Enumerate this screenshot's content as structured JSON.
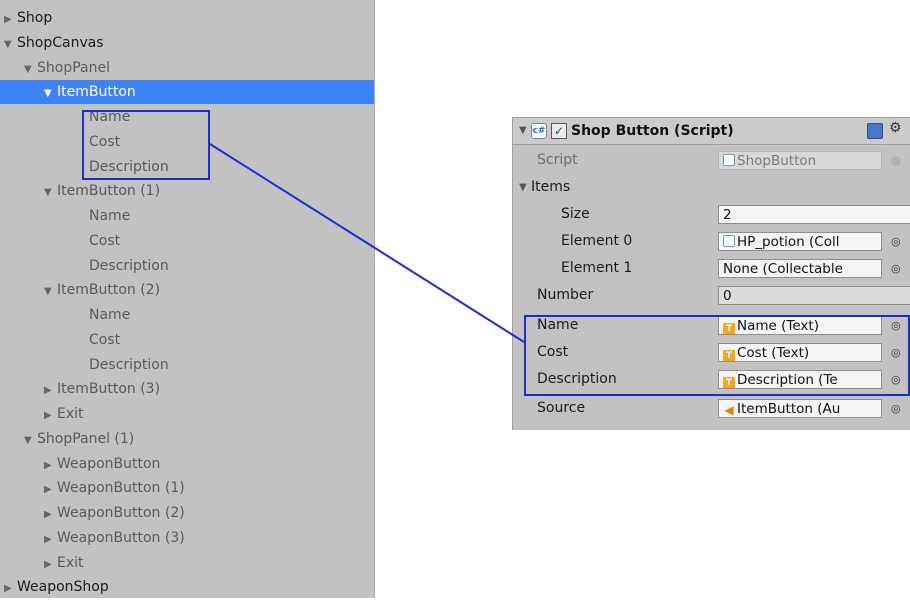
{
  "hierarchy": {
    "items": [
      {
        "label": "Shop",
        "arrow": "▶",
        "dim": false,
        "selected": false
      },
      {
        "label": "ShopCanvas",
        "arrow": "▼",
        "dim": false,
        "selected": false
      },
      {
        "label": "ShopPanel",
        "arrow": "▼",
        "dim": true,
        "selected": false
      },
      {
        "label": "ItemButton",
        "arrow": "▼",
        "dim": true,
        "selected": true
      },
      {
        "label": "Name",
        "arrow": "",
        "dim": true,
        "selected": false
      },
      {
        "label": "Cost",
        "arrow": "",
        "dim": true,
        "selected": false
      },
      {
        "label": "Description",
        "arrow": "",
        "dim": true,
        "selected": false
      },
      {
        "label": "ItemButton (1)",
        "arrow": "▼",
        "dim": true,
        "selected": false
      },
      {
        "label": "Name",
        "arrow": "",
        "dim": true,
        "selected": false
      },
      {
        "label": "Cost",
        "arrow": "",
        "dim": true,
        "selected": false
      },
      {
        "label": "Description",
        "arrow": "",
        "dim": true,
        "selected": false
      },
      {
        "label": "ItemButton (2)",
        "arrow": "▼",
        "dim": true,
        "selected": false
      },
      {
        "label": "Name",
        "arrow": "",
        "dim": true,
        "selected": false
      },
      {
        "label": "Cost",
        "arrow": "",
        "dim": true,
        "selected": false
      },
      {
        "label": "Description",
        "arrow": "",
        "dim": true,
        "selected": false
      },
      {
        "label": "ItemButton (3)",
        "arrow": "▶",
        "dim": true,
        "selected": false
      },
      {
        "label": "Exit",
        "arrow": "▶",
        "dim": true,
        "selected": false
      },
      {
        "label": "ShopPanel (1)",
        "arrow": "▼",
        "dim": true,
        "selected": false
      },
      {
        "label": "WeaponButton",
        "arrow": "▶",
        "dim": true,
        "selected": false
      },
      {
        "label": "WeaponButton (1)",
        "arrow": "▶",
        "dim": true,
        "selected": false
      },
      {
        "label": "WeaponButton (2)",
        "arrow": "▶",
        "dim": true,
        "selected": false
      },
      {
        "label": "WeaponButton (3)",
        "arrow": "▶",
        "dim": true,
        "selected": false
      },
      {
        "label": "Exit",
        "arrow": "▶",
        "dim": true,
        "selected": false
      },
      {
        "label": "WeaponShop",
        "arrow": "▶",
        "dim": false,
        "selected": false
      }
    ]
  },
  "inspector": {
    "component_title": "Shop Button (Script)",
    "script_label": "Script",
    "script_value": "ShopButton",
    "items_label": "Items",
    "size_label": "Size",
    "size_value": "2",
    "element0_label": "Element 0",
    "element0_value": "HP_potion (Coll",
    "element1_label": "Element 1",
    "element1_value": "None (Collectable",
    "number_label": "Number",
    "number_value": "0",
    "name_label": "Name",
    "name_value": "Name (Text)",
    "cost_label": "Cost",
    "cost_value": "Cost (Text)",
    "description_label": "Description",
    "description_value": "Description (Te",
    "source_label": "Source",
    "source_value": "ItemButton (Au"
  },
  "icons": {
    "foldout": "triangle-down-icon",
    "script": "csharp-script-icon",
    "enabled": "checkbox-icon",
    "help": "book-help-icon",
    "settings": "gear-icon",
    "text": "text-component-icon",
    "audio": "audio-source-icon",
    "picker": "object-picker-icon"
  },
  "colors": {
    "panel_bg": "#c2c2c2",
    "selection": "#3d83f5",
    "highlight_box": "#1b2bd6",
    "text_icon": "#f5a623"
  }
}
